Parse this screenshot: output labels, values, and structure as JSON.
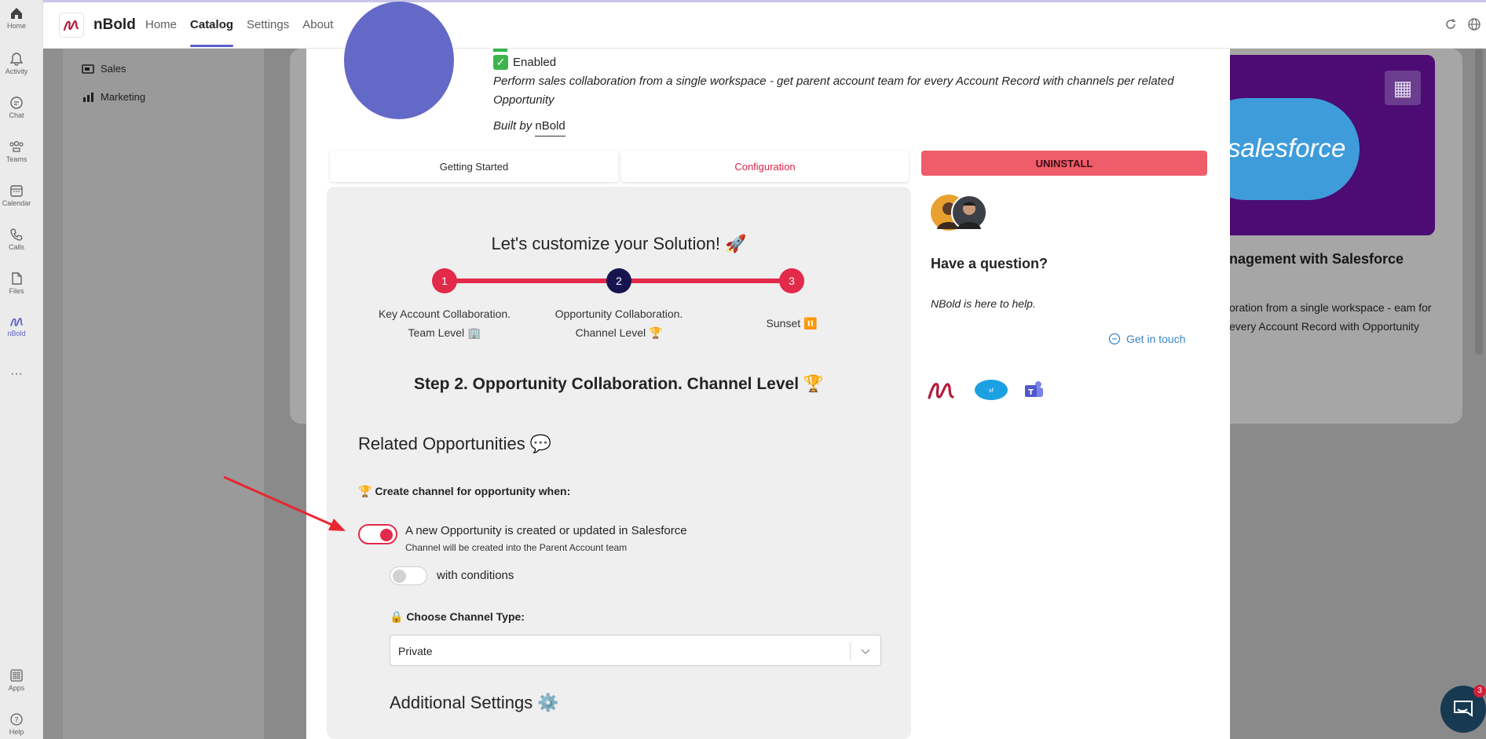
{
  "rail": {
    "items": [
      {
        "label": "Home",
        "icon": "home-icon"
      },
      {
        "label": "Activity",
        "icon": "bell-icon"
      },
      {
        "label": "Chat",
        "icon": "chat-icon"
      },
      {
        "label": "Teams",
        "icon": "teams-icon"
      },
      {
        "label": "Calendar",
        "icon": "calendar-icon"
      },
      {
        "label": "Calls",
        "icon": "phone-icon"
      },
      {
        "label": "Files",
        "icon": "file-icon"
      },
      {
        "label": "nBold",
        "icon": "nbold-icon"
      },
      {
        "label": "Apps",
        "icon": "apps-icon"
      },
      {
        "label": "Help",
        "icon": "help-icon"
      }
    ]
  },
  "header": {
    "app_name": "nBold",
    "nav": [
      "Home",
      "Catalog",
      "Settings",
      "About"
    ],
    "active_nav": "Catalog"
  },
  "sidebar": {
    "items": [
      "Sales",
      "Marketing"
    ]
  },
  "background_card": {
    "banner_text": "salesforce",
    "title": "nagement with Salesforce",
    "desc": "oration from a single workspace - eam for every Account Record with Opportunity"
  },
  "solution": {
    "status": "Enabled",
    "description": "Perform sales collaboration from a single workspace - get parent account team for every Account Record with channels per related Opportunity",
    "built_by_prefix": "Built by",
    "built_by": "nBold"
  },
  "tabs": {
    "getting_started": "Getting Started",
    "configuration": "Configuration",
    "uninstall": "UNINSTALL"
  },
  "config": {
    "title": "Let's customize your Solution! 🚀",
    "steps": [
      {
        "num": "1",
        "line1": "Key Account Collaboration.",
        "line2": "Team Level 🏢"
      },
      {
        "num": "2",
        "line1": "Opportunity Collaboration.",
        "line2": "Channel Level 🏆"
      },
      {
        "num": "3",
        "line1": "Sunset ⏸️",
        "line2": ""
      }
    ],
    "step_title": "Step 2. Opportunity Collaboration. Channel Level 🏆",
    "section_title": "Related Opportunities 💬",
    "create_label": "🏆 Create channel for opportunity when:",
    "option1": "A new Opportunity is created or updated in Salesforce",
    "option1_sub": "Channel will be created into the Parent Account team",
    "option1_enabled": true,
    "conditions_label": "with conditions",
    "conditions_enabled": false,
    "channel_type_label": "🔒 Choose Channel Type:",
    "channel_type_value": "Private",
    "additional_settings": "Additional Settings ⚙️"
  },
  "help_panel": {
    "question": "Have a question?",
    "help_text": "NBold is here to help.",
    "get_in_touch": "Get in touch"
  },
  "chat_widget": {
    "badge": "3"
  },
  "colors": {
    "accent": "#e22a4a",
    "teams_purple": "#5b5fc7",
    "link": "#3b87c8"
  }
}
